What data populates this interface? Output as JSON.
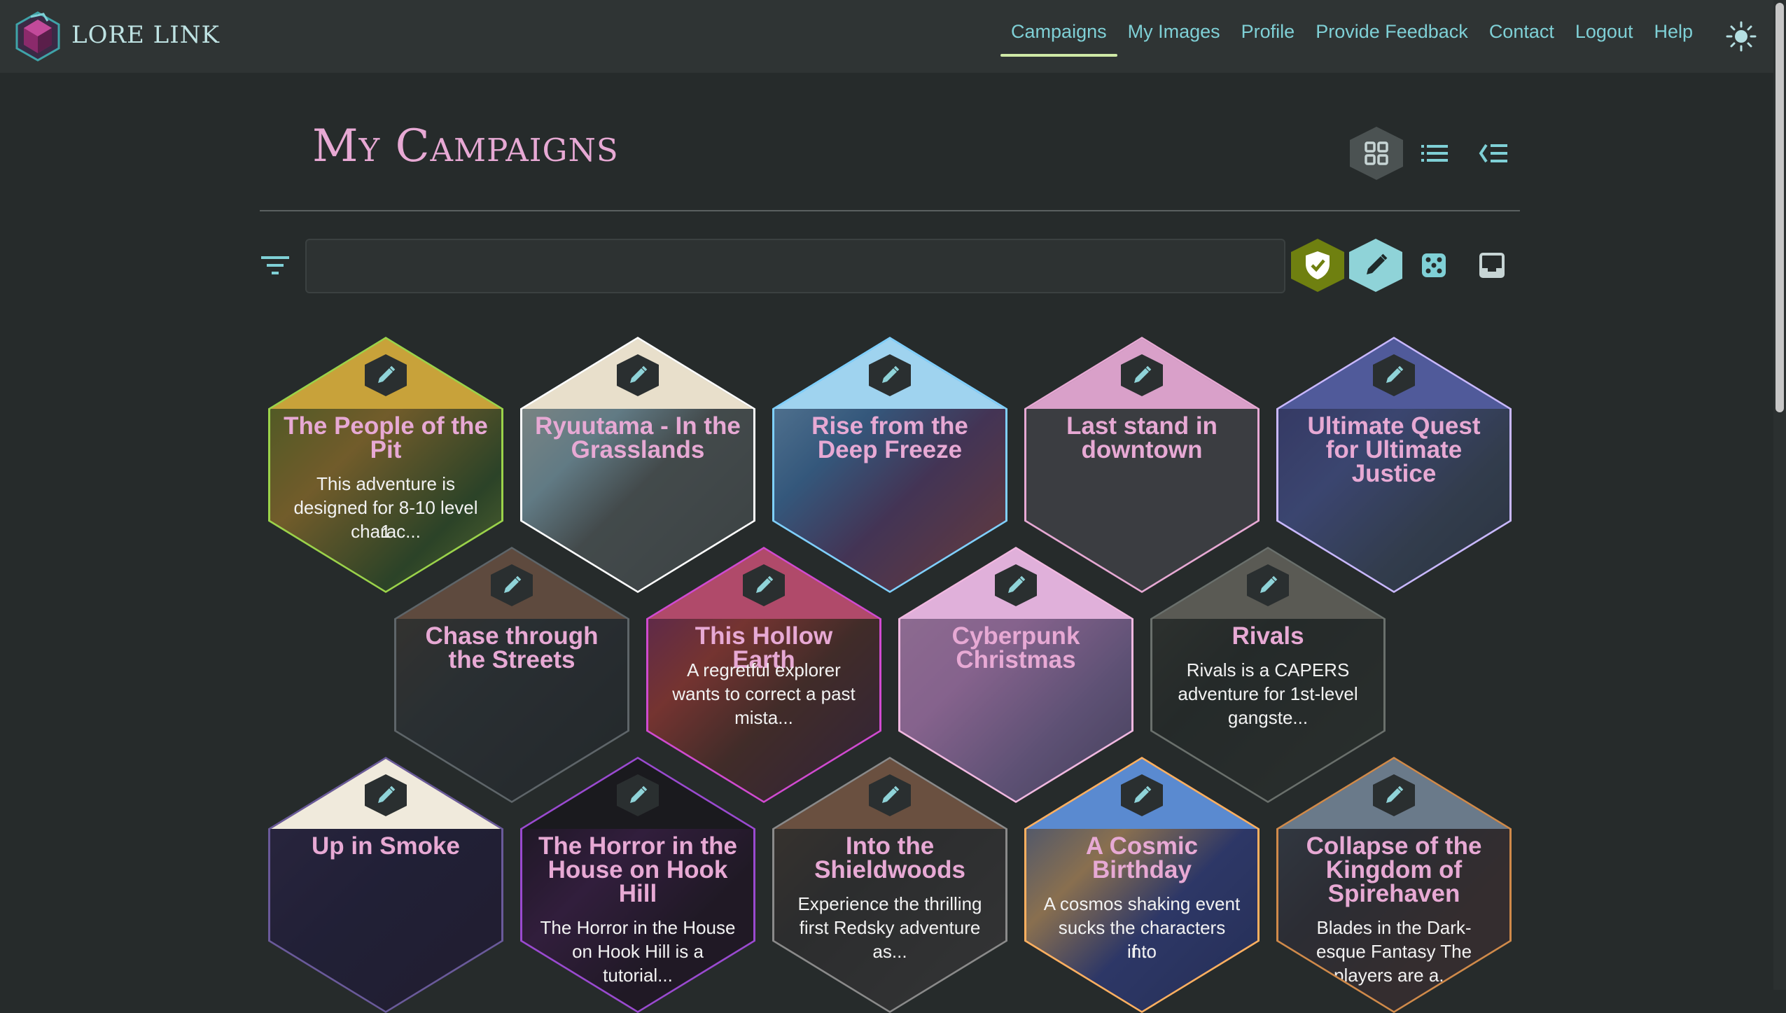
{
  "brand": {
    "name": "LORE LINK"
  },
  "nav": {
    "items": [
      "Campaigns",
      "My Images",
      "Profile",
      "Provide Feedback",
      "Contact",
      "Logout",
      "Help"
    ],
    "active": "Campaigns"
  },
  "page": {
    "title": "My Campaigns"
  },
  "search": {
    "value": "",
    "placeholder": ""
  },
  "colors": {
    "accent_pink": "#e7a9d4",
    "accent_teal": "#7fd0d6",
    "background": "#262b2b",
    "navbar": "#2f3434",
    "verified_green": "#7a8d12"
  },
  "icons": {
    "view_modes": [
      "grid-view-icon",
      "list-view-icon",
      "tree-view-icon"
    ],
    "filters": [
      "verified-shield-icon",
      "pencil-edit-icon",
      "dice-icon",
      "inbox-icon"
    ]
  },
  "campaigns": [
    {
      "title": "The People of the Pit",
      "desc": [
        "This adventure is",
        "designed for 8-10 level 1",
        "charac..."
      ]
    },
    {
      "title": "Ryuutama - In the Grasslands",
      "desc": []
    },
    {
      "title": "Rise from the Deep Freeze",
      "desc": []
    },
    {
      "title": "Last stand in downtown",
      "desc": []
    },
    {
      "title": "Ultimate Quest for Ultimate Justice",
      "desc": []
    },
    {
      "title": "Chase through the Streets",
      "desc": []
    },
    {
      "title": "This Hollow Earth",
      "desc": [
        "A regretful explorer",
        "wants to correct a past",
        "mista..."
      ]
    },
    {
      "title": "Cyberpunk Christmas",
      "desc": []
    },
    {
      "title": "Rivals",
      "desc": [
        "Rivals is a CAPERS",
        "adventure for 1st-level",
        "gangste..."
      ]
    },
    {
      "title": "Up in Smoke",
      "desc": []
    },
    {
      "title": "The Horror in the House on Hook Hill",
      "desc": [
        "The Horror in the House",
        "on Hook Hill is a",
        "tutorial..."
      ]
    },
    {
      "title": "Into the Shieldwoods",
      "desc": [
        "Experience the thrilling",
        "first Redsky adventure",
        "as..."
      ]
    },
    {
      "title": "A Cosmic Birthday",
      "desc": [
        "A cosmos shaking event",
        "sucks the characters into",
        "f..."
      ]
    },
    {
      "title": "Collapse of the Kingdom of Spirehaven",
      "desc": [
        "Blades in the Dark-",
        "esque Fantasy The",
        "players are a..."
      ]
    }
  ]
}
